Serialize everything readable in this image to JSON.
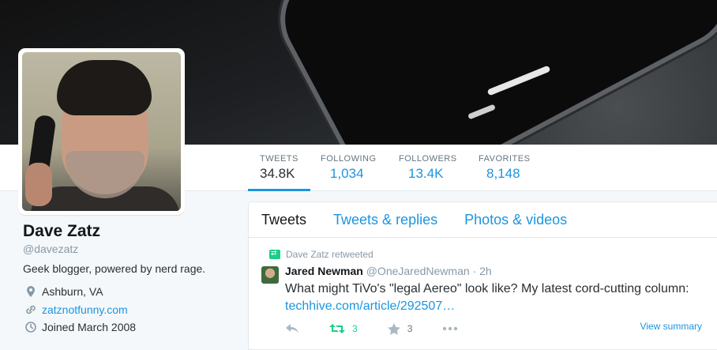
{
  "profile": {
    "name": "Dave Zatz",
    "handle": "@davezatz",
    "bio": "Geek blogger, powered by nerd rage.",
    "location": "Ashburn, VA",
    "website": "zatznotfunny.com",
    "joined": "Joined March 2008"
  },
  "stats": [
    {
      "label": "TWEETS",
      "value": "34.8K"
    },
    {
      "label": "FOLLOWING",
      "value": "1,034"
    },
    {
      "label": "FOLLOWERS",
      "value": "13.4K"
    },
    {
      "label": "FAVORITES",
      "value": "8,148"
    }
  ],
  "tabs": [
    {
      "label": "Tweets"
    },
    {
      "label": "Tweets & replies"
    },
    {
      "label": "Photos & videos"
    }
  ],
  "tweet": {
    "retweeted_by": "Dave Zatz retweeted",
    "author_name": "Jared Newman",
    "author_handle": "@OneJaredNewman",
    "separator": "·",
    "time": "2h",
    "text": "What might TiVo's \"legal Aereo\" look like? My latest cord-cutting column:",
    "link": "techhive.com/article/292507…",
    "retweets": "3",
    "favorites": "3",
    "view_summary": "View summary"
  },
  "colors": {
    "accent": "#1b95e0",
    "retweet": "#19cf86",
    "background": "#f5f8fa"
  }
}
